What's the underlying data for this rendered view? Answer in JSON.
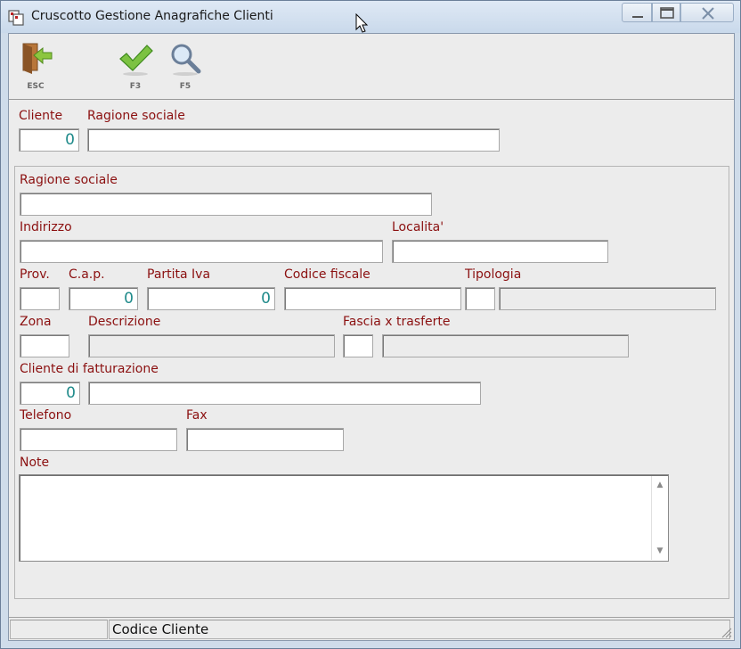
{
  "window": {
    "title": "Cruscotto Gestione Anagrafiche Clienti"
  },
  "toolbar": {
    "esc_label": "ESC",
    "f3_label": "F3",
    "f5_label": "F5"
  },
  "header": {
    "cliente_label": "Cliente",
    "cliente_value": "0",
    "ragione_sociale_label": "Ragione sociale",
    "ragione_sociale_value": ""
  },
  "form": {
    "ragione_sociale_label": "Ragione sociale",
    "ragione_sociale_value": "",
    "indirizzo_label": "Indirizzo",
    "indirizzo_value": "",
    "localita_label": "Localita'",
    "localita_value": "",
    "prov_label": "Prov.",
    "prov_value": "",
    "cap_label": "C.a.p.",
    "cap_value": "0",
    "partita_iva_label": "Partita Iva",
    "partita_iva_value": "0",
    "codice_fiscale_label": "Codice fiscale",
    "codice_fiscale_value": "",
    "tipologia_label": "Tipologia",
    "tipologia_code": "",
    "tipologia_desc": "",
    "zona_label": "Zona",
    "zona_value": "",
    "descrizione_label": "Descrizione",
    "descrizione_value": "",
    "fascia_label": "Fascia x trasferte",
    "fascia_code": "",
    "fascia_desc": "",
    "cliente_fatturazione_label": "Cliente di fatturazione",
    "cliente_fatturazione_code": "0",
    "cliente_fatturazione_name": "",
    "telefono_label": "Telefono",
    "telefono_value": "",
    "fax_label": "Fax",
    "fax_value": "",
    "note_label": "Note",
    "note_value": ""
  },
  "statusbar": {
    "left_text": "",
    "right_text": "Codice Cliente"
  },
  "colors": {
    "label": "#8b1010",
    "value": "#1f8a8a",
    "window_frame": "#cfdcea"
  },
  "icons": {
    "esc": "exit-door-icon",
    "f3": "checkmark-icon",
    "f5": "magnifier-icon"
  }
}
